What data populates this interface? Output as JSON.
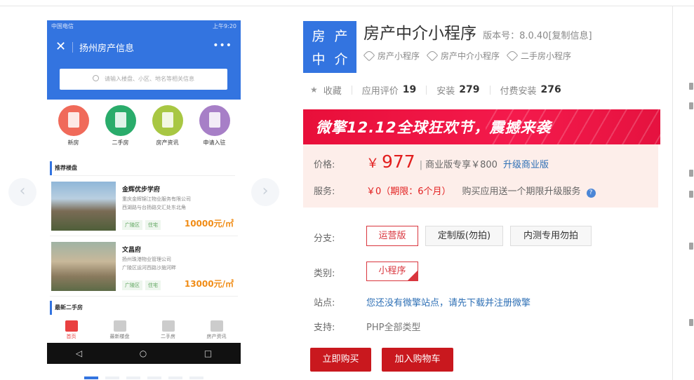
{
  "phone": {
    "carrier": "中国电信",
    "status_right": "上午9:20",
    "close_glyph": "✕",
    "title": "扬州房产信息",
    "more_glyph": "•••",
    "search_placeholder": "请输入楼盘、小区、地名等相关信息",
    "categories": [
      {
        "label": "新房",
        "color": "#f06a5a"
      },
      {
        "label": "二手房",
        "color": "#2aac6b"
      },
      {
        "label": "房产资讯",
        "color": "#a8c743"
      },
      {
        "label": "申请入驻",
        "color": "#a77fc7"
      }
    ],
    "section1": "推荐楼盘",
    "listings": [
      {
        "name": "金辉优步学府",
        "line1": "重庆金辉锦江物业服务有限公司",
        "line2": "西湖路与台扬路交汇处东北角",
        "tags": [
          "广陵区",
          "住宅"
        ],
        "price": "10000元/㎡"
      },
      {
        "name": "文昌府",
        "line1": "扬州珠港物业管理公司",
        "line2": "广陵区运河西路沙施河畔",
        "tags": [
          "广陵区",
          "住宅"
        ],
        "price": "13000元/㎡"
      }
    ],
    "section2": "最新二手房",
    "nav": [
      "首页",
      "最新楼盘",
      "二手房",
      "房产资讯"
    ],
    "sys_keys": [
      "◁",
      "○",
      "□"
    ]
  },
  "gallery": {
    "prev_glyph": "‹",
    "next_glyph": "›"
  },
  "logo_chars": [
    "房",
    "产",
    "中",
    "介"
  ],
  "product": {
    "name": "房产中介小程序",
    "version": "版本号：8.0.40",
    "copy_label": "[复制信息]",
    "tags": [
      "房产小程序",
      "房产中介小程序",
      "二手房小程序"
    ]
  },
  "stats": {
    "star_glyph": "★",
    "favorite": "收藏",
    "rating_label": "应用评价",
    "rating": "19",
    "installs_label": "安装",
    "installs": "279",
    "paid_label": "付费安装",
    "paid": "276"
  },
  "banner": "微擎12.12全球狂欢节，震撼来袭",
  "pricing": {
    "price_label": "价格:",
    "currency": "￥",
    "price": "977",
    "separator": "|",
    "business_text": "商业版专享￥800",
    "upgrade_link": "升级商业版",
    "service_label": "服务:",
    "service_value": "￥0（期限：6个月）",
    "service_note": "购买应用送一个期限升级服务",
    "help_glyph": "?"
  },
  "options": {
    "branch_label": "分支:",
    "branches": [
      "运营版",
      "定制版(勿拍)",
      "内测专用勿拍"
    ],
    "category_label": "类别:",
    "category": "小程序",
    "site_label": "站点:",
    "site_text": "您还没有微擎站点，请先下载并注册微擎",
    "support_label": "支持:",
    "support_text": "PHP全部类型"
  },
  "actions": {
    "buy": "立即购买",
    "cart": "加入购物车"
  },
  "colors": {
    "brand_blue": "#3374e0",
    "accent_red": "#c9181e",
    "price_red": "#e21e1e",
    "banner_red": "#f41a4c",
    "link_blue": "#2d6fb5"
  }
}
